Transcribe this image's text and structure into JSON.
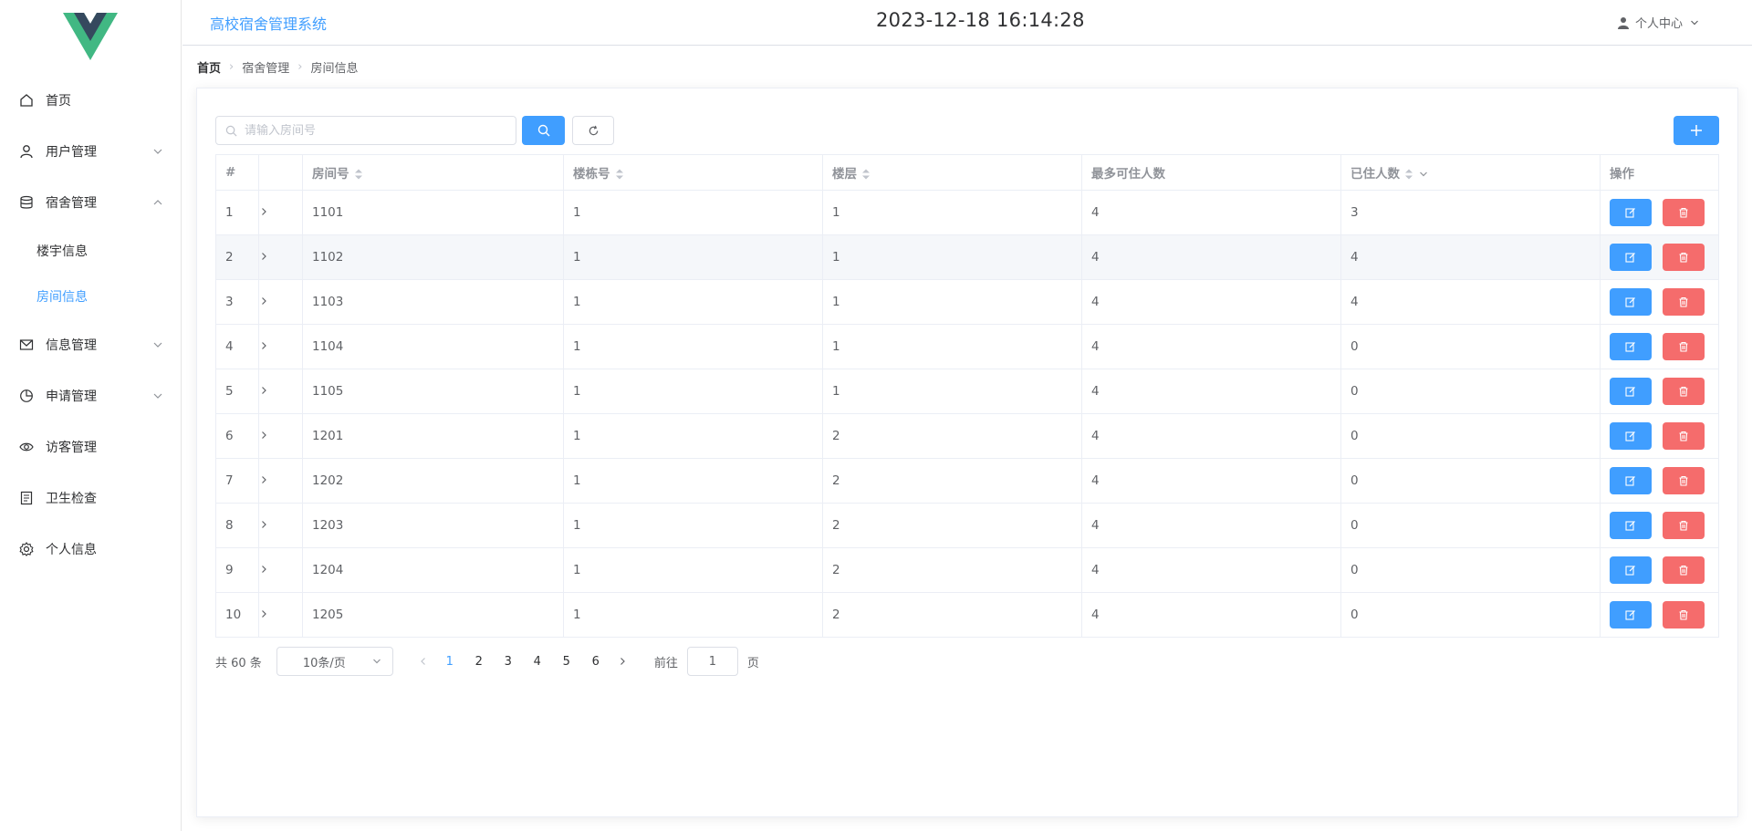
{
  "colors": {
    "primary": "#409eff",
    "danger": "#f56c6c",
    "logo_green": "#41b883",
    "logo_dark": "#35495e"
  },
  "logo": {
    "icon": "vue-logo-icon"
  },
  "header": {
    "title": "高校宿舍管理系统",
    "datetime": "2023-12-18 16:14:28",
    "user_menu": "个人中心"
  },
  "sidebar": {
    "items": [
      {
        "label": "首页",
        "icon": "home-icon"
      },
      {
        "label": "用户管理",
        "icon": "user-icon",
        "expandable": true
      },
      {
        "label": "宿舍管理",
        "icon": "database-icon",
        "expandable": true,
        "expanded": true
      },
      {
        "label": "信息管理",
        "icon": "message-icon",
        "expandable": true
      },
      {
        "label": "申请管理",
        "icon": "pie-chart-icon",
        "expandable": true
      },
      {
        "label": "访客管理",
        "icon": "eye-icon"
      },
      {
        "label": "卫生检查",
        "icon": "document-icon"
      },
      {
        "label": "个人信息",
        "icon": "setting-icon"
      }
    ],
    "subitems": [
      {
        "label": "楼宇信息"
      },
      {
        "label": "房间信息",
        "active": true
      }
    ]
  },
  "breadcrumb": [
    "首页",
    "宿舍管理",
    "房间信息"
  ],
  "search": {
    "placeholder": "请输入房间号",
    "value": ""
  },
  "table": {
    "columns": [
      "#",
      "",
      "房间号",
      "楼栋号",
      "楼层",
      "最多可住人数",
      "已住人数",
      "操作"
    ],
    "rows": [
      [
        "1",
        "1101",
        "1",
        "1",
        "4",
        "3"
      ],
      [
        "2",
        "1102",
        "1",
        "1",
        "4",
        "4"
      ],
      [
        "3",
        "1103",
        "1",
        "1",
        "4",
        "4"
      ],
      [
        "4",
        "1104",
        "1",
        "1",
        "4",
        "0"
      ],
      [
        "5",
        "1105",
        "1",
        "1",
        "4",
        "0"
      ],
      [
        "6",
        "1201",
        "1",
        "2",
        "4",
        "0"
      ],
      [
        "7",
        "1202",
        "1",
        "2",
        "4",
        "0"
      ],
      [
        "8",
        "1203",
        "1",
        "2",
        "4",
        "0"
      ],
      [
        "9",
        "1204",
        "1",
        "2",
        "4",
        "0"
      ],
      [
        "10",
        "1205",
        "1",
        "2",
        "4",
        "0"
      ]
    ]
  },
  "pagination": {
    "total_text": "共 60 条",
    "page_size": "10条/页",
    "pages": [
      "1",
      "2",
      "3",
      "4",
      "5",
      "6"
    ],
    "current": "1",
    "goto_label": "前往",
    "goto_value": "1",
    "page_suffix": "页"
  }
}
